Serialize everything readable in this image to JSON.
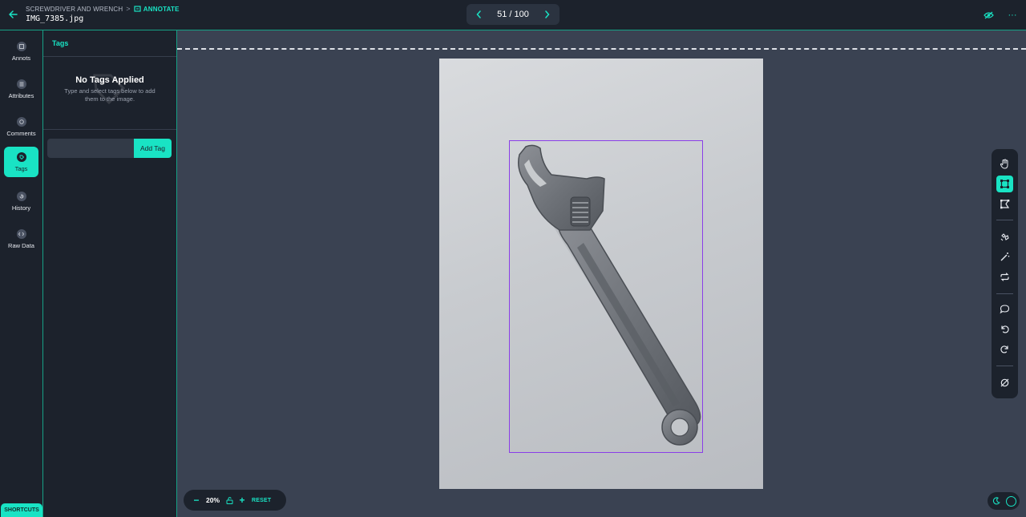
{
  "header": {
    "project_name": "SCREWDRIVER AND WRENCH",
    "separator": ">",
    "mode_label": "ANNOTATE",
    "filename": "IMG_7385.jpg",
    "pager_text": "51 / 100",
    "more_glyph": "···"
  },
  "rail": {
    "items": [
      {
        "label": "Annots",
        "icon": "annotations-icon"
      },
      {
        "label": "Attributes",
        "icon": "attributes-icon"
      },
      {
        "label": "Comments",
        "icon": "comment-icon"
      },
      {
        "label": "Tags",
        "icon": "tag-icon",
        "active": true
      },
      {
        "label": "History",
        "icon": "history-icon"
      },
      {
        "label": "Raw Data",
        "icon": "code-icon"
      }
    ],
    "shortcuts_label": "SHORTCUTS"
  },
  "tags_panel": {
    "title": "Tags",
    "empty_title": "No Tags Applied",
    "empty_desc": "Type and select tags below to add them to the image.",
    "input_value": "",
    "add_button": "Add Tag"
  },
  "zoom": {
    "minus": "−",
    "value": "20%",
    "plus": "+",
    "reset": "RESET"
  },
  "toolbar": {
    "tools": [
      "pan-hand-icon",
      "bounding-box-icon",
      "polygon-icon",
      "smart-select-icon",
      "magic-wand-icon",
      "repeat-icon",
      "comment-icon",
      "undo-icon",
      "redo-icon",
      "hide-annotations-icon"
    ],
    "active_tool": "bounding-box-icon"
  },
  "colors": {
    "accent": "#19e3c4",
    "bbox": "#8a3ee8",
    "panel_bg": "#1c222c",
    "canvas_bg": "#3a4252"
  }
}
